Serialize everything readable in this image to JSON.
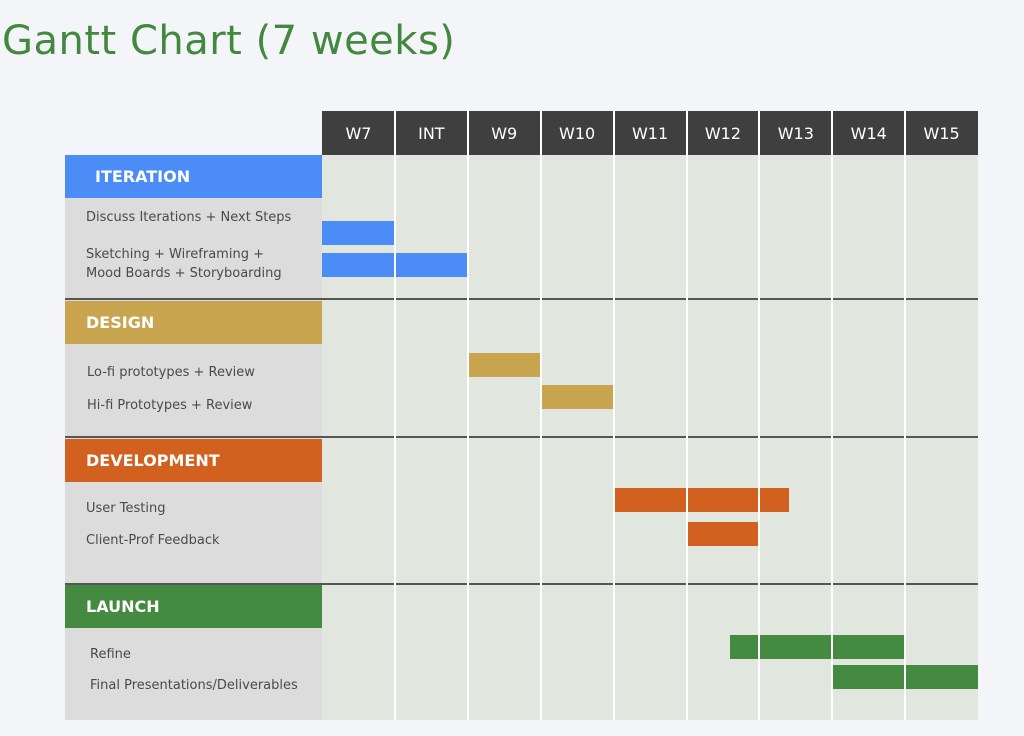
{
  "title": "Gantt Chart (7 weeks)",
  "chart_data": {
    "type": "gantt",
    "columns": [
      "W7",
      "INT",
      "W9",
      "W10",
      "W11",
      "W12",
      "W13",
      "W14",
      "W15"
    ],
    "phases": [
      {
        "name": "ITERATION",
        "color": "#4b8cf7",
        "tasks": [
          {
            "label": "Discuss Iterations + Next Steps",
            "start": 0,
            "end": 1
          },
          {
            "label": "Sketching + Wireframing +\nMood Boards + Storyboarding",
            "start": 0,
            "end": 2
          }
        ]
      },
      {
        "name": "DESIGN",
        "color": "#c9a54f",
        "tasks": [
          {
            "label": "Lo-fi prototypes + Review",
            "start": 2,
            "end": 3
          },
          {
            "label": "Hi-fi Prototypes + Review",
            "start": 3,
            "end": 4
          }
        ]
      },
      {
        "name": "DEVELOPMENT",
        "color": "#d2611f",
        "tasks": [
          {
            "label": "User Testing",
            "start": 4,
            "end": 6.4
          },
          {
            "label": "Client-Prof Feedback",
            "start": 5,
            "end": 6
          }
        ]
      },
      {
        "name": "LAUNCH",
        "color": "#448a41",
        "tasks": [
          {
            "label": "Refine",
            "start": 5.6,
            "end": 8
          },
          {
            "label": "Final Presentations/Deliverables",
            "start": 7,
            "end": 9
          }
        ]
      }
    ]
  }
}
